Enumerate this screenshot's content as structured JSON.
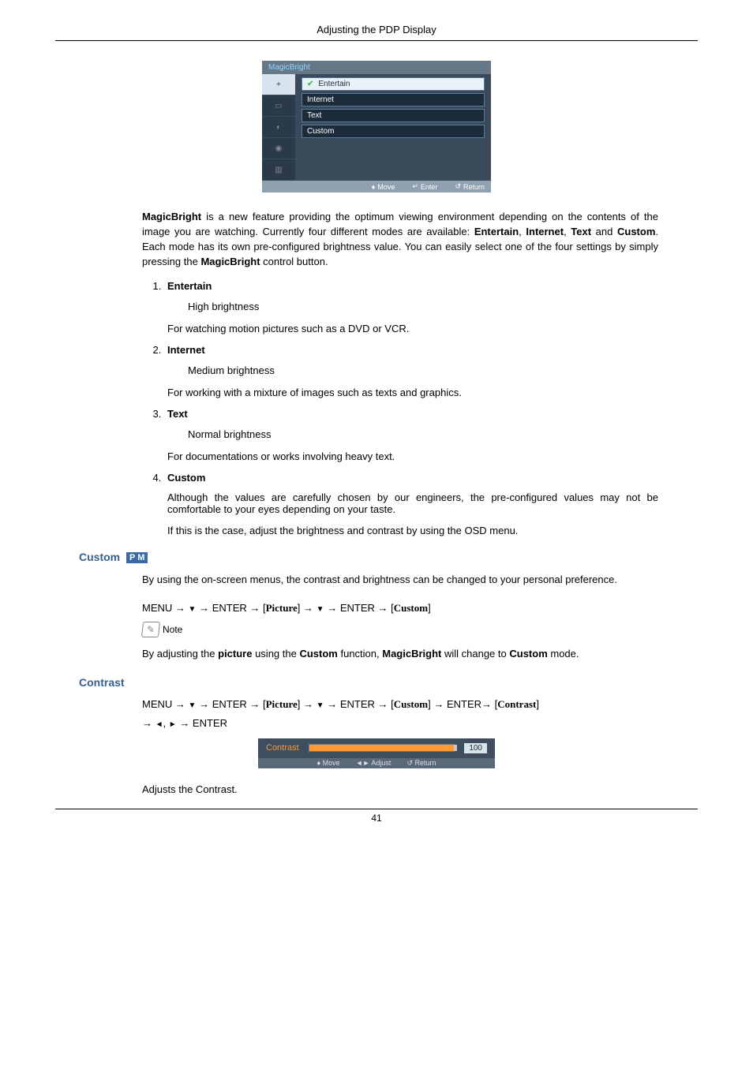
{
  "header": {
    "title": "Adjusting the PDP Display"
  },
  "osd_menu": {
    "title": "MagicBright",
    "items": [
      "Entertain",
      "Internet",
      "Text",
      "Custom"
    ],
    "footer": {
      "move": "Move",
      "enter": "Enter",
      "return": "Return"
    }
  },
  "intro": {
    "text_parts": {
      "a": "MagicBright",
      "b": " is a new feature providing the optimum viewing environment depending on the contents of the image you are watching. Currently four different modes are available: ",
      "c": "Entertain",
      "d": ", ",
      "e": "Internet",
      "f": ", ",
      "g": "Text",
      "h": " and ",
      "i": "Custom",
      "j": ". Each mode has its own pre-configured brightness value. You can easily select one of the four settings by simply pressing the ",
      "k": "MagicBright",
      "l": " control button."
    }
  },
  "modes": [
    {
      "name": "Entertain",
      "sub": "High brightness",
      "desc": "For watching motion pictures such as a DVD or VCR."
    },
    {
      "name": "Internet",
      "sub": "Medium brightness",
      "desc": "For working with a mixture of images such as texts and graphics."
    },
    {
      "name": "Text",
      "sub": "Normal brightness",
      "desc": "For documentations or works involving heavy text."
    },
    {
      "name": "Custom",
      "sub": "",
      "desc": "Although the values are carefully chosen by our engineers, the pre-configured values may not be comfortable to your eyes depending on your taste.",
      "desc2": "If this is the case, adjust the brightness and contrast by using the OSD menu."
    }
  ],
  "custom_section": {
    "heading": "Custom",
    "pm_label": "P M",
    "body": "By using the on-screen menus, the contrast and brightness can be changed to your personal preference.",
    "menu_path": {
      "menu": "MENU",
      "enter": "ENTER",
      "picture": "Picture",
      "custom": "Custom"
    },
    "note_label": "Note",
    "note_parts": {
      "a": "By adjusting the ",
      "b": "picture",
      "c": " using the ",
      "d": "Custom",
      "e": " function, ",
      "f": "MagicBright",
      "g": " will change to ",
      "h": "Custom",
      "i": " mode."
    }
  },
  "contrast_section": {
    "heading": "Contrast",
    "menu_path": {
      "menu": "MENU",
      "enter": "ENTER",
      "picture": "Picture",
      "custom": "Custom",
      "contrast": "Contrast"
    },
    "slider": {
      "label": "Contrast",
      "value": "100",
      "footer": {
        "move": "Move",
        "adjust": "Adjust",
        "return": "Return"
      }
    },
    "body": "Adjusts the Contrast."
  },
  "page_number": "41"
}
